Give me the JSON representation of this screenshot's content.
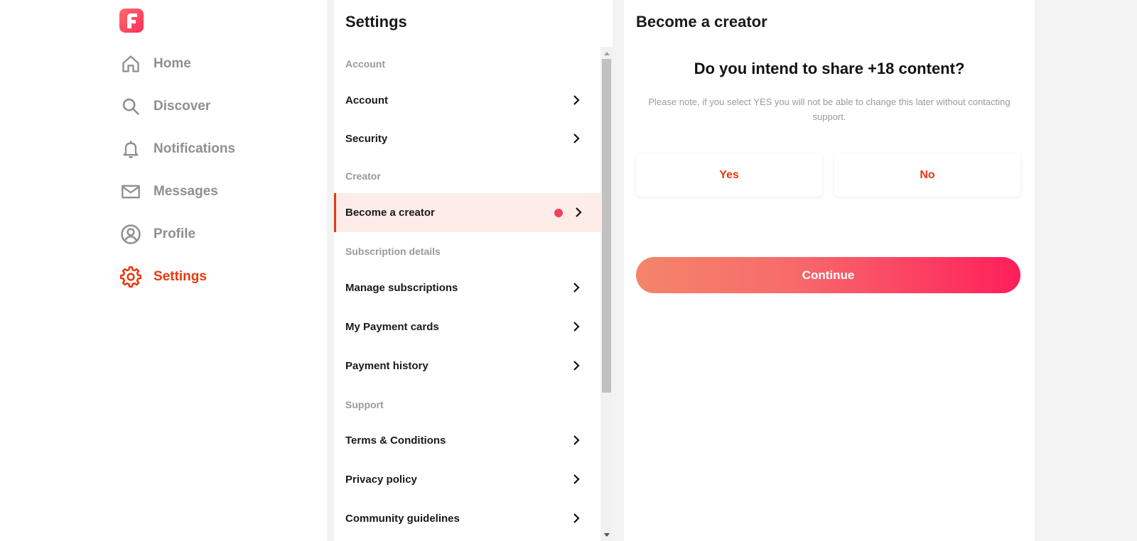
{
  "nav": {
    "items": [
      {
        "label": "Home",
        "icon": "home-icon"
      },
      {
        "label": "Discover",
        "icon": "search-icon"
      },
      {
        "label": "Notifications",
        "icon": "bell-icon"
      },
      {
        "label": "Messages",
        "icon": "mail-icon"
      },
      {
        "label": "Profile",
        "icon": "profile-icon"
      },
      {
        "label": "Settings",
        "icon": "gear-icon",
        "active": true
      }
    ]
  },
  "settings": {
    "title": "Settings",
    "sections": {
      "account": "Account",
      "creator": "Creator",
      "subscription": "Subscription details",
      "support": "Support"
    },
    "items": {
      "account": "Account",
      "security": "Security",
      "become_creator": "Become a creator",
      "manage_subscriptions": "Manage subscriptions",
      "payment_cards": "My Payment cards",
      "payment_history": "Payment history",
      "terms": "Terms & Conditions",
      "privacy": "Privacy policy",
      "community": "Community guidelines"
    }
  },
  "panel": {
    "title": "Become a creator",
    "question": "Do you intend to share +18 content?",
    "note": "Please note, if you select YES you will not be able to change this later without contacting support.",
    "yes_label": "Yes",
    "no_label": "No",
    "continue_label": "Continue"
  },
  "colors": {
    "accent": "#e8380d",
    "nav_inactive": "#8f8f8f",
    "active_row_bg": "#fdece7",
    "notification_dot": "#f0425a"
  }
}
